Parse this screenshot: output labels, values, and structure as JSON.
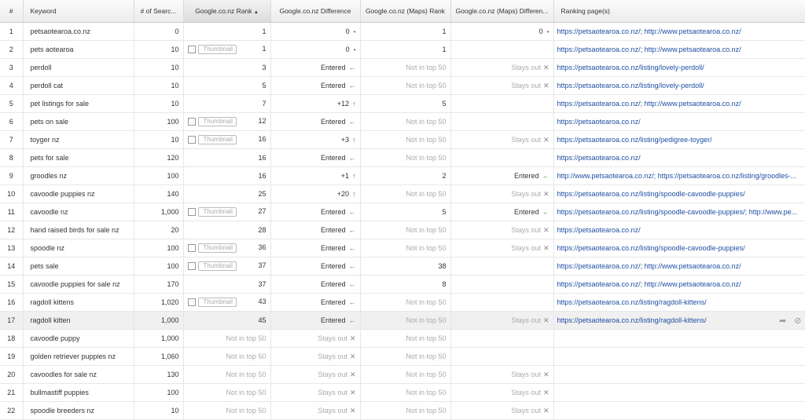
{
  "headers": {
    "num": "#",
    "keyword": "Keyword",
    "searches": "# of Searc...",
    "rank": "Google.co.nz Rank",
    "sort_arrow": "▲",
    "diff": "Google.co.nz Difference",
    "maps_rank": "Google.co.nz (Maps) Rank",
    "maps_diff": "Google.co.nz (Maps) Differen...",
    "pages": "Ranking page(s)"
  },
  "thumbnail_label": "Thumbnail",
  "icons": {
    "up": "arrow-up-icon",
    "entered": "arrow-left-icon",
    "x": "close-icon",
    "dot": "dot-icon",
    "share": "share-icon",
    "link": "link-icon"
  },
  "colors": {
    "link": "#1f4fa3",
    "arrow": "#3a9a3a",
    "muted": "#aaaaaa"
  },
  "rows": [
    {
      "n": "1",
      "kw": "petsaotearoa.co.nz",
      "searches": "0",
      "thumb": false,
      "rank": "1",
      "diff": "0",
      "diff_icon": "dot",
      "maps_rank": "1",
      "maps_diff": "0",
      "maps_diff_icon": "dot",
      "pages": "https://petsaotearoa.co.nz/; http://www.petsaotearoa.co.nz/"
    },
    {
      "n": "2",
      "kw": "pets aotearoa",
      "searches": "10",
      "thumb": true,
      "rank": "1",
      "diff": "0",
      "diff_icon": "dot",
      "maps_rank": "1",
      "maps_diff": "",
      "maps_diff_icon": "",
      "pages": "https://petsaotearoa.co.nz/; http://www.petsaotearoa.co.nz/"
    },
    {
      "n": "3",
      "kw": "perdoll",
      "searches": "10",
      "thumb": false,
      "rank": "3",
      "diff": "Entered",
      "diff_icon": "entered",
      "maps_rank": "Not in top 50",
      "maps_diff": "Stays out",
      "maps_diff_icon": "x",
      "pages": "https://petsaotearoa.co.nz/listing/lovely-perdoll/"
    },
    {
      "n": "4",
      "kw": "perdoll cat",
      "searches": "10",
      "thumb": false,
      "rank": "5",
      "diff": "Entered",
      "diff_icon": "entered",
      "maps_rank": "Not in top 50",
      "maps_diff": "Stays out",
      "maps_diff_icon": "x",
      "pages": "https://petsaotearoa.co.nz/listing/lovely-perdoll/"
    },
    {
      "n": "5",
      "kw": "pet listings for sale",
      "searches": "10",
      "thumb": false,
      "rank": "7",
      "diff": "+12",
      "diff_icon": "up",
      "maps_rank": "5",
      "maps_diff": "",
      "maps_diff_icon": "",
      "pages": "https://petsaotearoa.co.nz/; http://www.petsaotearoa.co.nz/"
    },
    {
      "n": "6",
      "kw": "pets on sale",
      "searches": "100",
      "thumb": true,
      "rank": "12",
      "diff": "Entered",
      "diff_icon": "entered",
      "maps_rank": "Not in top 50",
      "maps_diff": "",
      "maps_diff_icon": "",
      "pages": "https://petsaotearoa.co.nz/"
    },
    {
      "n": "7",
      "kw": "toyger nz",
      "searches": "10",
      "thumb": true,
      "rank": "16",
      "diff": "+3",
      "diff_icon": "up",
      "maps_rank": "Not in top 50",
      "maps_diff": "Stays out",
      "maps_diff_icon": "x",
      "pages": "https://petsaotearoa.co.nz/listing/pedigree-toyger/"
    },
    {
      "n": "8",
      "kw": "pets for sale",
      "searches": "120",
      "thumb": false,
      "rank": "16",
      "diff": "Entered",
      "diff_icon": "entered",
      "maps_rank": "Not in top 50",
      "maps_diff": "",
      "maps_diff_icon": "",
      "pages": "https://petsaotearoa.co.nz/"
    },
    {
      "n": "9",
      "kw": "groodles nz",
      "searches": "100",
      "thumb": false,
      "rank": "16",
      "diff": "+1",
      "diff_icon": "up",
      "maps_rank": "2",
      "maps_diff": "Entered",
      "maps_diff_icon": "entered",
      "pages": "http://www.petsaotearoa.co.nz/; https://petsaotearoa.co.nz/listing/groodles-..."
    },
    {
      "n": "10",
      "kw": "cavoodle puppies nz",
      "searches": "140",
      "thumb": false,
      "rank": "25",
      "diff": "+20",
      "diff_icon": "up",
      "maps_rank": "Not in top 50",
      "maps_diff": "Stays out",
      "maps_diff_icon": "x",
      "pages": "https://petsaotearoa.co.nz/listing/spoodle-cavoodle-puppies/"
    },
    {
      "n": "11",
      "kw": "cavoodle nz",
      "searches": "1,000",
      "thumb": true,
      "rank": "27",
      "diff": "Entered",
      "diff_icon": "entered",
      "maps_rank": "5",
      "maps_diff": "Entered",
      "maps_diff_icon": "entered",
      "pages": "https://petsaotearoa.co.nz/listing/spoodle-cavoodle-puppies/; http://www.pe..."
    },
    {
      "n": "12",
      "kw": "hand raised birds for sale nz",
      "searches": "20",
      "thumb": false,
      "rank": "28",
      "diff": "Entered",
      "diff_icon": "entered",
      "maps_rank": "Not in top 50",
      "maps_diff": "Stays out",
      "maps_diff_icon": "x",
      "pages": "https://petsaotearoa.co.nz/"
    },
    {
      "n": "13",
      "kw": "spoodle nz",
      "searches": "100",
      "thumb": true,
      "rank": "36",
      "diff": "Entered",
      "diff_icon": "entered",
      "maps_rank": "Not in top 50",
      "maps_diff": "Stays out",
      "maps_diff_icon": "x",
      "pages": "https://petsaotearoa.co.nz/listing/spoodle-cavoodle-puppies/"
    },
    {
      "n": "14",
      "kw": "pets sale",
      "searches": "100",
      "thumb": true,
      "rank": "37",
      "diff": "Entered",
      "diff_icon": "entered",
      "maps_rank": "38",
      "maps_diff": "",
      "maps_diff_icon": "",
      "pages": "https://petsaotearoa.co.nz/; http://www.petsaotearoa.co.nz/"
    },
    {
      "n": "15",
      "kw": "cavoodle puppies for sale nz",
      "searches": "170",
      "thumb": false,
      "rank": "37",
      "diff": "Entered",
      "diff_icon": "entered",
      "maps_rank": "8",
      "maps_diff": "",
      "maps_diff_icon": "",
      "pages": "https://petsaotearoa.co.nz/; http://www.petsaotearoa.co.nz/"
    },
    {
      "n": "16",
      "kw": "ragdoll kittens",
      "searches": "1,020",
      "thumb": true,
      "rank": "43",
      "diff": "Entered",
      "diff_icon": "entered",
      "maps_rank": "Not in top 50",
      "maps_diff": "",
      "maps_diff_icon": "",
      "pages": "https://petsaotearoa.co.nz/listing/ragdoll-kittens/"
    },
    {
      "n": "17",
      "kw": "ragdoll kitten",
      "searches": "1,000",
      "thumb": false,
      "rank": "45",
      "diff": "Entered",
      "diff_icon": "entered",
      "maps_rank": "Not in top 50",
      "maps_diff": "Stays out",
      "maps_diff_icon": "x",
      "pages": "https://petsaotearoa.co.nz/listing/ragdoll-kittens/",
      "highlight": true
    },
    {
      "n": "18",
      "kw": "cavoodle puppy",
      "searches": "1,000",
      "thumb": false,
      "rank": "Not in top 50",
      "diff": "Stays out",
      "diff_icon": "x",
      "maps_rank": "Not in top 50",
      "maps_diff": "",
      "maps_diff_icon": "",
      "pages": ""
    },
    {
      "n": "19",
      "kw": "golden retriever puppies nz",
      "searches": "1,060",
      "thumb": false,
      "rank": "Not in top 50",
      "diff": "Stays out",
      "diff_icon": "x",
      "maps_rank": "Not in top 50",
      "maps_diff": "",
      "maps_diff_icon": "",
      "pages": ""
    },
    {
      "n": "20",
      "kw": "cavoodles for sale nz",
      "searches": "130",
      "thumb": false,
      "rank": "Not in top 50",
      "diff": "Stays out",
      "diff_icon": "x",
      "maps_rank": "Not in top 50",
      "maps_diff": "Stays out",
      "maps_diff_icon": "x",
      "pages": ""
    },
    {
      "n": "21",
      "kw": "bullmastiff puppies",
      "searches": "100",
      "thumb": false,
      "rank": "Not in top 50",
      "diff": "Stays out",
      "diff_icon": "x",
      "maps_rank": "Not in top 50",
      "maps_diff": "Stays out",
      "maps_diff_icon": "x",
      "pages": ""
    },
    {
      "n": "22",
      "kw": "spoodle breeders nz",
      "searches": "10",
      "thumb": false,
      "rank": "Not in top 50",
      "diff": "Stays out",
      "diff_icon": "x",
      "maps_rank": "Not in top 50",
      "maps_diff": "Stays out",
      "maps_diff_icon": "x",
      "pages": ""
    }
  ]
}
